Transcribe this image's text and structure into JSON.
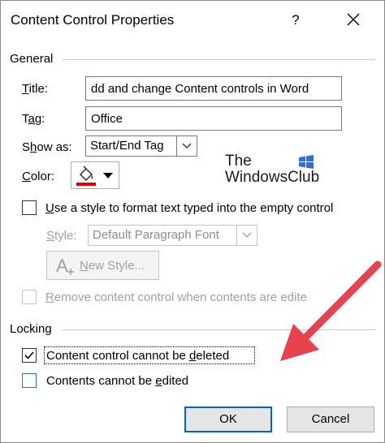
{
  "window": {
    "title": "Content Control Properties",
    "help_label": "?"
  },
  "general": {
    "section_label": "General",
    "title_label_rest": "itle:",
    "title_label_u": "T",
    "title_value": "dd and change Content controls in Word",
    "tag_label_a": "T",
    "tag_label_u": "a",
    "tag_label_b": "g:",
    "tag_value": "Office",
    "showas_label_a": "S",
    "showas_label_u": "h",
    "showas_label_b": "ow as:",
    "showas_value": "Start/End Tag",
    "color_label_u": "C",
    "color_label_rest": "olor:",
    "use_style_label_u": "U",
    "use_style_label_rest": "se a style to format text typed into the empty control",
    "style_label_u": "S",
    "style_label_rest": "tyle:",
    "style_value": "Default Paragraph Font",
    "new_style_u": "N",
    "new_style_rest": "ew Style...",
    "remove_label_u": "R",
    "remove_label_rest": "emove content control when contents are edite"
  },
  "locking": {
    "section_label": "Locking",
    "cannot_delete_a": "Content control cannot be ",
    "cannot_delete_u": "d",
    "cannot_delete_b": "eleted",
    "cannot_edit_a": "Contents cannot be ",
    "cannot_edit_u": "e",
    "cannot_edit_b": "dited"
  },
  "buttons": {
    "ok": "OK",
    "cancel": "Cancel"
  },
  "watermark": {
    "line1": "The",
    "line2": "WindowsClub"
  },
  "colors": {
    "accent": "#0067c0",
    "arrow": "#e8424f",
    "color_swatch": "#e00000"
  }
}
